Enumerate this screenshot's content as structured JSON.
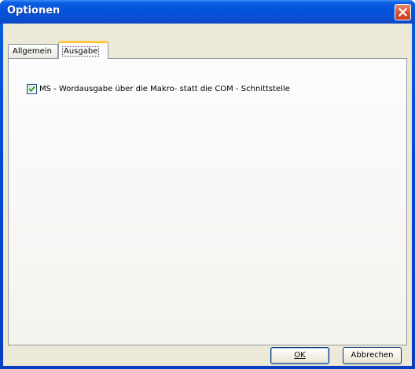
{
  "window": {
    "title": "Optionen"
  },
  "tabs": [
    {
      "label": "Allgemein",
      "active": false
    },
    {
      "label": "Ausgabe",
      "active": true
    }
  ],
  "options": {
    "word_macro_output": {
      "label": "MS - Wordausgabe über die Makro- statt die COM - Schnittstelle",
      "checked": true
    }
  },
  "buttons": {
    "ok": "OK",
    "cancel": "Abbrechen"
  },
  "icons": {
    "close": "close-icon",
    "check": "checkmark-icon"
  },
  "colors": {
    "titlebar": "#0553db",
    "close_button": "#d8522b",
    "dialog_face": "#ece9d8",
    "active_tab_accent": "#ffc83c",
    "checkmark": "#21a121"
  }
}
